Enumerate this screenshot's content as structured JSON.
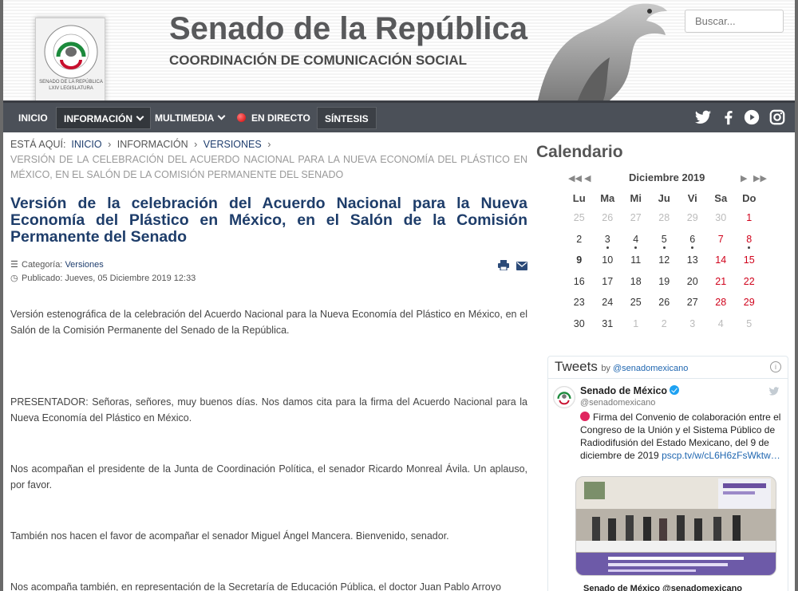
{
  "header": {
    "title": "Senado de la República",
    "subtitle": "COORDINACIÓN DE COMUNICACIÓN SOCIAL",
    "seal_top_text": "SENADO DE LA REPÚBLICA",
    "seal_bottom_text": "LXIV LEGISLATURA",
    "search_placeholder": "Buscar..."
  },
  "nav": {
    "items": [
      {
        "label": "INICIO"
      },
      {
        "label": "INFORMACIÓN"
      },
      {
        "label": "MULTIMEDIA"
      },
      {
        "label": "EN DIRECTO"
      },
      {
        "label": "SÍNTESIS"
      }
    ],
    "social_icons": [
      "twitter-icon",
      "facebook-icon",
      "youtube-icon",
      "instagram-icon"
    ]
  },
  "breadcrumb": {
    "prefix": "ESTÁ AQUÍ:",
    "items": [
      "INICIO",
      "INFORMACIÓN",
      "VERSIONES"
    ],
    "current": "VERSIÓN DE LA CELEBRACIÓN DEL ACUERDO NACIONAL PARA LA NUEVA ECONOMÍA DEL PLÁSTICO EN MÉXICO, EN EL SALÓN DE LA COMISIÓN PERMANENTE DEL SENADO"
  },
  "article": {
    "title": "Versión de la celebración del Acuerdo Nacional para la Nueva Economía del Plástico en México, en el Salón de la Comisión Permanente del Senado",
    "category_label": "Categoría:",
    "category": "Versiones",
    "published": "Publicado: Jueves, 05 Diciembre 2019 12:33",
    "paragraphs": [
      "Versión estenográfica de la celebración del Acuerdo Nacional para la Nueva Economía del Plástico en México, en el Salón de la Comisión Permanente del Senado de la República.",
      "PRESENTADOR: Señoras, señores, muy buenos días. Nos damos cita para la firma del Acuerdo Nacional para la Nueva Economía del Plástico en México.",
      "Nos acompañan el presidente de la Junta de Coordinación Política, el senador Ricardo Monreal Ávila. Un aplauso, por favor.",
      "También nos hacen el favor de acompañar el senador Miguel Ángel Mancera. Bienvenido, senador.",
      "Nos acompaña también, en representación de la Secretaría de Educación Pública, el doctor Juan Pablo Arroyo"
    ]
  },
  "calendar": {
    "title": "Calendario",
    "month": "Diciembre 2019",
    "weekdays": [
      "Lu",
      "Ma",
      "Mi",
      "Ju",
      "Vi",
      "Sa",
      "Do"
    ],
    "weeks": [
      [
        "25",
        "26",
        "27",
        "28",
        "29",
        "30",
        "1"
      ],
      [
        "2",
        "3",
        "4",
        "5",
        "6",
        "7",
        "8"
      ],
      [
        "9",
        "10",
        "11",
        "12",
        "13",
        "14",
        "15"
      ],
      [
        "16",
        "17",
        "18",
        "19",
        "20",
        "21",
        "22"
      ],
      [
        "23",
        "24",
        "25",
        "26",
        "27",
        "28",
        "29"
      ],
      [
        "30",
        "31",
        "1",
        "2",
        "3",
        "4",
        "5"
      ]
    ]
  },
  "tweets": {
    "title": "Tweets",
    "by": "by",
    "by_handle": "@senadomexicano",
    "info": "i",
    "name": "Senado de México",
    "handle": "@senadomexicano",
    "text": "Firma del Convenio de colaboración entre el Congreso de la Unión y el Sistema Público de Radiodifusión del Estado Mexicano, del 9 de diciembre de 2019",
    "link": "pscp.tv/w/cL6H6zFsWktw…",
    "next_tweet": "Senado de México @senadomexicano"
  }
}
